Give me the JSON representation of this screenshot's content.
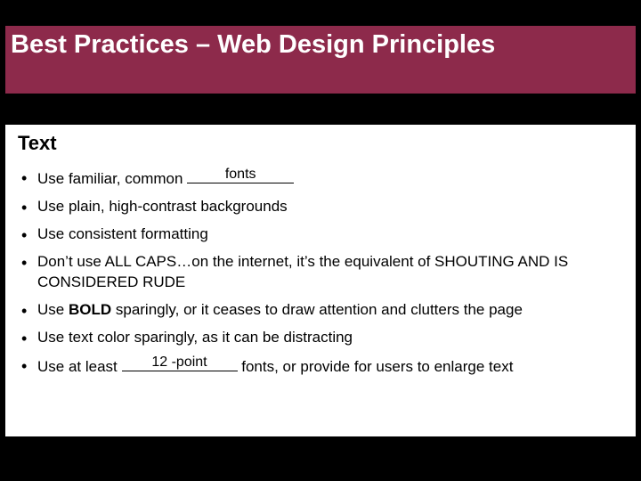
{
  "title": "Best Practices – Web Design Principles",
  "subhead": "Text",
  "bullets": {
    "b1": {
      "pre": "Use familiar, common ",
      "fill": "fonts"
    },
    "b2": "Use plain, high-contrast backgrounds",
    "b3": "Use consistent formatting",
    "b4": "Don’t use ALL CAPS…on the internet, it’s the equivalent of SHOUTING AND IS CONSIDERED RUDE",
    "b5": {
      "pre": "Use ",
      "bold": "BOLD",
      "post": " sparingly, or it ceases to draw attention and clutters the page"
    },
    "b6": "Use text color sparingly, as it can be distracting",
    "b7": {
      "pre": "Use at least ",
      "fill": "12 -point",
      "post": " fonts, or provide for users to enlarge text"
    }
  }
}
